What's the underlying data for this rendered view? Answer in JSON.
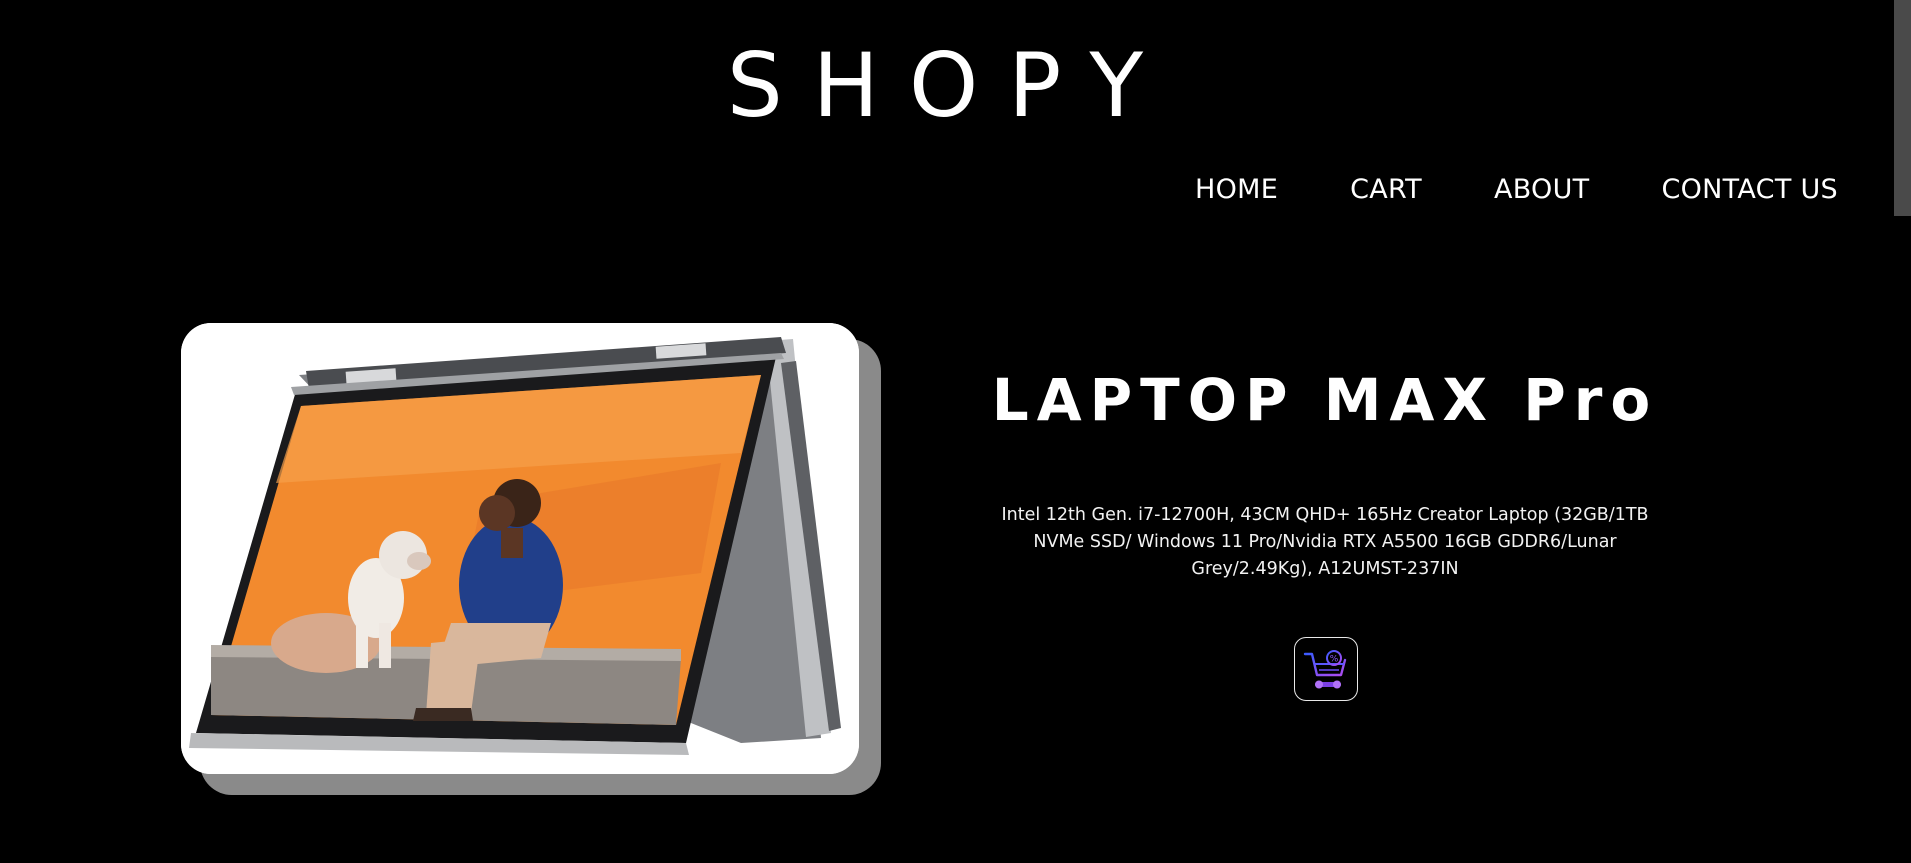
{
  "header": {
    "brand": "SHOPY"
  },
  "nav": {
    "items": [
      {
        "label": "HOME"
      },
      {
        "label": "CART"
      },
      {
        "label": "ABOUT"
      },
      {
        "label": "CONTACT US"
      }
    ]
  },
  "product": {
    "title": "LAPTOP MAX Pro",
    "description": "Intel 12th Gen. i7-12700H, 43CM QHD+ 165Hz Creator Laptop (32GB/1TB NVMe SSD/ Windows 11 Pro/Nvidia RTX A5500 16GB GDDR6/Lunar Grey/2.49Kg), A12UMST-237IN",
    "image_icon": "laptop-tent-mode-photo",
    "cart_icon": "cart-discount-icon"
  },
  "colors": {
    "background": "#000000",
    "text": "#ffffff",
    "accent": "#7b3fe4",
    "accent_blue": "#3b5bff"
  }
}
